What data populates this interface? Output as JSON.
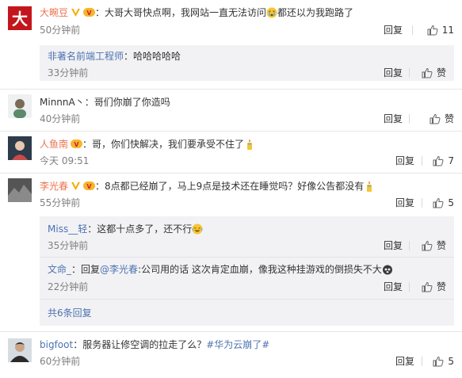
{
  "actions": {
    "reply_label": "回复",
    "like_label": "赞"
  },
  "comments": [
    {
      "user": "大畹豆",
      "sep": "：",
      "text_a": "大哥大哥快点啊，我网站一直无法访问",
      "text_b": "都还以为我跑路了",
      "time": "50分钟前",
      "likes": "11"
    },
    {
      "user": "MinnnA丶",
      "sep": "：",
      "text": "哥们你崩了你造吗",
      "time": "40分钟前"
    },
    {
      "user": "人鱼南",
      "sep": "：",
      "text": "哥，你们快解决，我们要承受不住了",
      "time": "今天 09:51",
      "likes": "7"
    },
    {
      "user": "李光春",
      "sep": "：",
      "text": "8点都已经崩了，马上9点是技术还在睡觉吗？好像公告都没有",
      "time": "55分钟前",
      "likes": "5"
    },
    {
      "user": "bigfoot",
      "sep": "：",
      "text": "服务器让修空调的拉走了么？",
      "hashtag": "#华为云崩了#",
      "time": "60分钟前",
      "likes": "5"
    }
  ],
  "replies": [
    {
      "user": "非著名前端工程师",
      "sep": "：",
      "text": "哈哈哈哈哈",
      "time": "33分钟前"
    },
    {
      "user": "Miss__轻",
      "sep": "：",
      "text": "这都十点多了，还不行",
      "time": "35分钟前"
    },
    {
      "user": "文命_",
      "sep": "：",
      "text_pre": "回复",
      "mention": "@李光春",
      "text_post": ":公司用的话 这次肯定血崩，像我这种挂游戏的倒损失不大",
      "time": "22分钟前"
    }
  ],
  "more_replies": "共6条回复",
  "colors": {
    "username": "#eb7350",
    "link": "#4d73b0",
    "meta": "#808080",
    "reply_bg": "#f2f2f5"
  }
}
